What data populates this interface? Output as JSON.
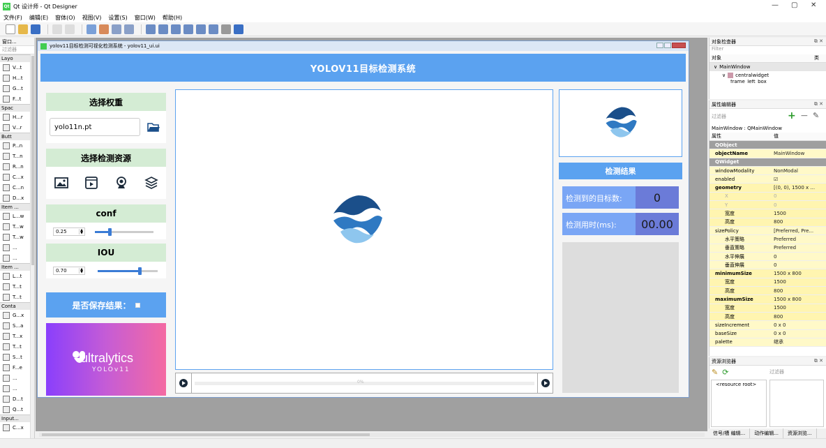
{
  "window": {
    "title": "Qt 设计师 - Qt Designer"
  },
  "menubar": [
    "文件(F)",
    "编辑(E)",
    "窗体(O)",
    "视图(V)",
    "设置(S)",
    "窗口(W)",
    "帮助(H)"
  ],
  "widgetbox": {
    "title": "窗口...",
    "filter": "过滤器",
    "categories": [
      {
        "label": "Layo",
        "items": [
          "V...t",
          "H...t",
          "G...t",
          "F...t"
        ]
      },
      {
        "label": "Spac",
        "items": [
          "H...r",
          "V...r"
        ]
      },
      {
        "label": "Butt",
        "items": [
          "P...n",
          "T...n",
          "R...n",
          "C...x",
          "C...n",
          "D...x"
        ]
      },
      {
        "label": "Item ...",
        "items": [
          "L...w",
          "T...w",
          "T...w",
          "...",
          "..."
        ]
      },
      {
        "label": "Item ...",
        "items": [
          "L...t",
          "T...t",
          "T...t"
        ]
      },
      {
        "label": "Conta",
        "items": [
          "G...x",
          "S...a",
          "T...x",
          "T...t",
          "S...t",
          "F...e",
          "...",
          "...",
          "D...t",
          "Q...t"
        ]
      },
      {
        "label": "Input...",
        "items": [
          "C...x"
        ]
      }
    ]
  },
  "form": {
    "window_title": "yolov11目标检测可视化检测系统 - yolov11_ui.ui",
    "header": "YOLOV11目标检测系统",
    "weight": {
      "title": "选择权重",
      "value": "yolo11n.pt"
    },
    "source": {
      "title": "选择检测资源"
    },
    "conf": {
      "title": "conf",
      "value": "0.25",
      "level": 0.25
    },
    "iou": {
      "title": "IOU",
      "value": "0.70",
      "level": 0.7
    },
    "save": {
      "label": "是否保存结果："
    },
    "brand": {
      "word": "ultralytics",
      "sub": "YOLOv11"
    },
    "progress_text": "0%",
    "result": {
      "title": "检测结果",
      "count_label": "检测到的目标数:",
      "count_value": "0",
      "time_label": "检测用时(ms):",
      "time_value": "00.00"
    }
  },
  "object_inspector": {
    "title": "对象检查器",
    "filter": "Filter",
    "col_object": "对象",
    "col_class": "类",
    "rows": [
      "MainWindow",
      "centralwidget",
      "frame_left_box"
    ]
  },
  "property_editor": {
    "title": "属性编辑器",
    "filter": "过滤器",
    "context": "MainWindow : QMainWindow",
    "col_prop": "属性",
    "col_value": "值",
    "rows": [
      {
        "k": "QObject",
        "v": "",
        "type": "cat"
      },
      {
        "k": "objectName",
        "v": "MainWindow",
        "type": "yellow bold"
      },
      {
        "k": "QWidget",
        "v": "",
        "type": "cat"
      },
      {
        "k": "windowModality",
        "v": "NonModal",
        "type": "yellow"
      },
      {
        "k": "enabled",
        "v": "☑",
        "type": "yellow"
      },
      {
        "k": "geometry",
        "v": "[(0, 0), 1500 x ...",
        "type": "yellow2 bold"
      },
      {
        "k": "X",
        "v": "0",
        "type": "yellow2 sub dim"
      },
      {
        "k": "Y",
        "v": "0",
        "type": "yellow2 sub dim"
      },
      {
        "k": "宽度",
        "v": "1500",
        "type": "yellow2 sub"
      },
      {
        "k": "高度",
        "v": "800",
        "type": "yellow2 sub"
      },
      {
        "k": "sizePolicy",
        "v": "[Preferred, Pre...",
        "type": "yellow"
      },
      {
        "k": "水平策略",
        "v": "Preferred",
        "type": "yellow sub"
      },
      {
        "k": "垂直策略",
        "v": "Preferred",
        "type": "yellow sub"
      },
      {
        "k": "水平伸展",
        "v": "0",
        "type": "yellow sub"
      },
      {
        "k": "垂直伸展",
        "v": "0",
        "type": "yellow sub"
      },
      {
        "k": "minimumSize",
        "v": "1500 x 800",
        "type": "yellow2 bold"
      },
      {
        "k": "宽度",
        "v": "1500",
        "type": "yellow2 sub"
      },
      {
        "k": "高度",
        "v": "800",
        "type": "yellow2 sub"
      },
      {
        "k": "maximumSize",
        "v": "1500 x 800",
        "type": "yellow2 bold"
      },
      {
        "k": "宽度",
        "v": "1500",
        "type": "yellow2 sub"
      },
      {
        "k": "高度",
        "v": "800",
        "type": "yellow2 sub"
      },
      {
        "k": "sizeIncrement",
        "v": "0 x 0",
        "type": "yellow"
      },
      {
        "k": "baseSize",
        "v": "0 x 0",
        "type": "yellow"
      },
      {
        "k": "palette",
        "v": "继承",
        "type": "yellow"
      }
    ]
  },
  "resource_browser": {
    "title": "资源浏览器",
    "filter": "过滤器",
    "root": "<resource root>"
  },
  "bottom_tabs": [
    "信号/槽 编辑...",
    "动作编辑...",
    "资源浏览..."
  ]
}
